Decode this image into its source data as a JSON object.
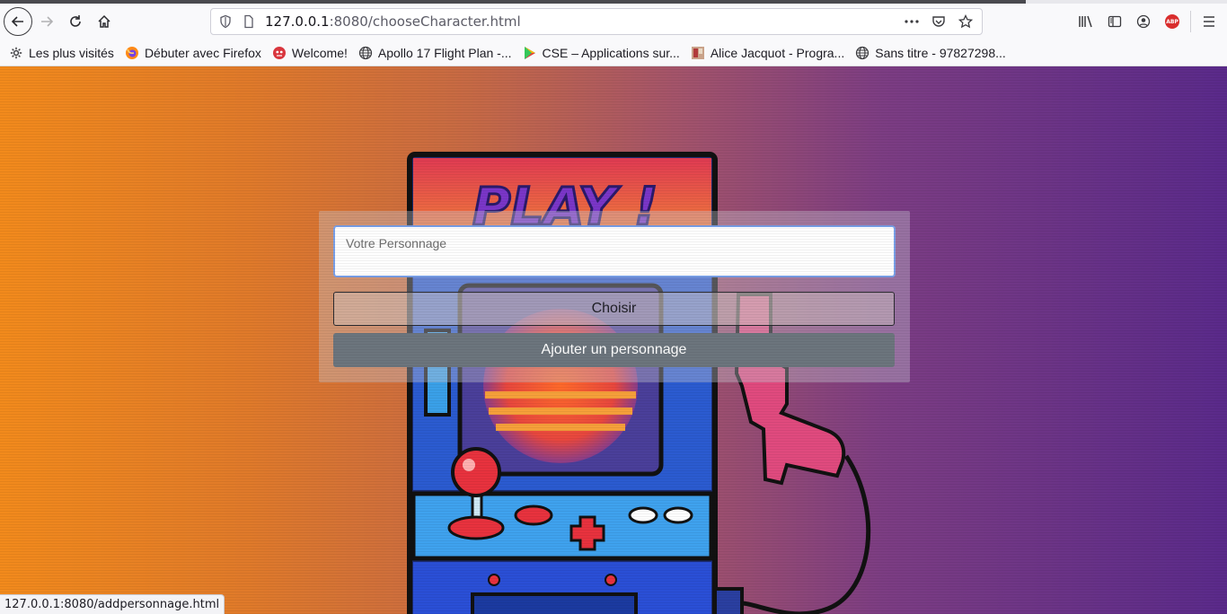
{
  "browser": {
    "url_host": "127.0.0.1",
    "url_rest": ":8080/chooseCharacter.html",
    "status_url": "127.0.0.1:8080/addpersonnage.html",
    "icons": {
      "back": "back-arrow-icon",
      "forward": "forward-arrow-icon",
      "reload": "reload-icon",
      "home": "home-icon",
      "shield": "tracking-shield-icon",
      "page": "page-icon",
      "more": "more-dots-icon",
      "pocket": "pocket-icon",
      "bookmark_star": "star-icon",
      "library": "library-icon",
      "sidebar": "sidebar-icon",
      "account": "account-icon",
      "adblock": "adblock-icon",
      "menu": "hamburger-menu-icon"
    },
    "adblock_label": "ABP"
  },
  "bookmarks": [
    {
      "label": "Les plus visités",
      "icon": "gear-icon"
    },
    {
      "label": "Débuter avec Firefox",
      "icon": "firefox-icon"
    },
    {
      "label": "Welcome!",
      "icon": "red-avatar-icon"
    },
    {
      "label": "Apollo 17 Flight Plan -...",
      "icon": "globe-icon"
    },
    {
      "label": "CSE – Applications sur...",
      "icon": "play-store-icon"
    },
    {
      "label": "Alice Jacquot - Progra...",
      "icon": "image-thumb-icon"
    },
    {
      "label": "Sans titre - 97827298...",
      "icon": "globe-icon"
    }
  ],
  "form": {
    "input_placeholder": "Votre Personnage",
    "input_value": "",
    "choose_label": "Choisir",
    "add_label": "Ajouter un personnage"
  },
  "background": {
    "arcade_sign_text": "PLAY !"
  },
  "colors": {
    "gradient_left": "#f28a1c",
    "gradient_right": "#5a2a8a",
    "add_button": "#6c757d",
    "input_focus_border": "#7aa0e8"
  }
}
